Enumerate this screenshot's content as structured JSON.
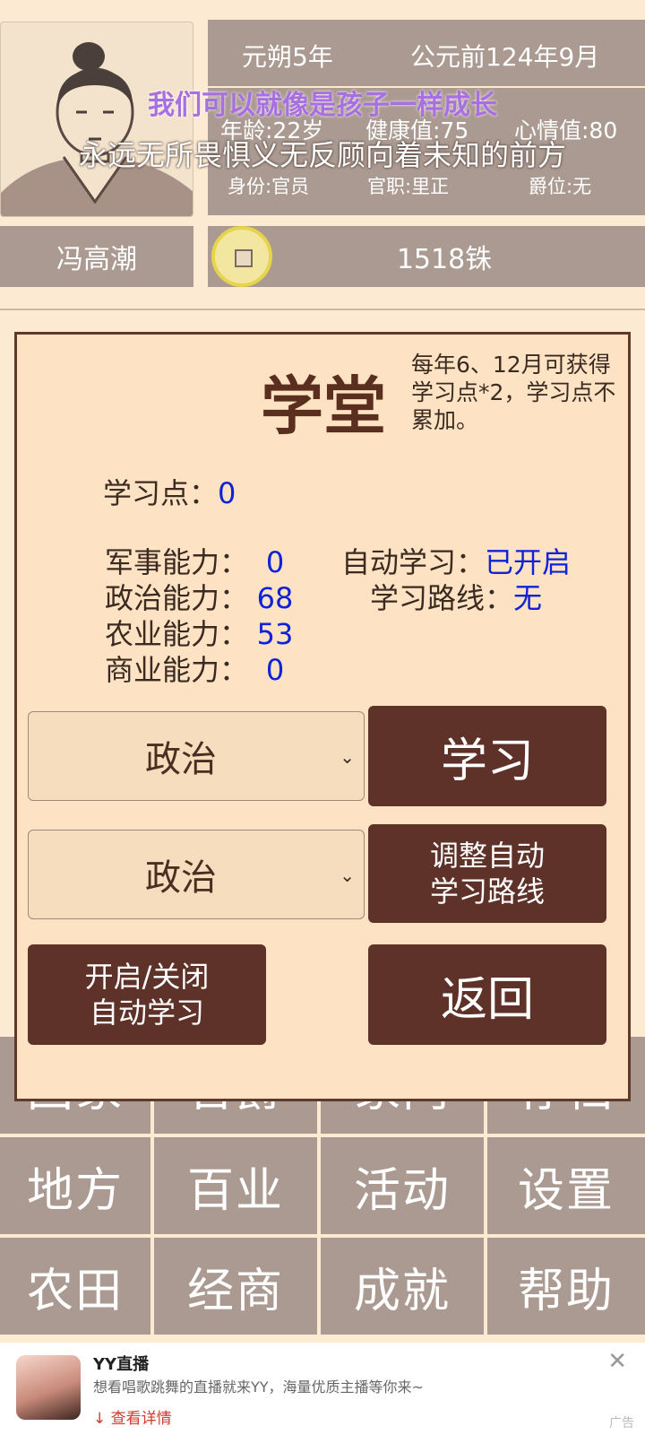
{
  "header": {
    "era": "元朔5年",
    "date": "公元前124年9月",
    "age": "年龄:22岁",
    "health": "健康值:75",
    "mood": "心情值:80",
    "identity": "身份:官员",
    "office": "官职:里正",
    "title_rank": "爵位:无",
    "name": "冯高潮",
    "money": "1518铢"
  },
  "lyrics": {
    "line1": "我们可以就像是孩子一样成长",
    "line2": "永远无所畏惧义无反顾向着未知的前方"
  },
  "modal": {
    "title": "学堂",
    "description": "每年6、12月可获得学习点*2，学习点不累加。",
    "study_points_label": "学习点：",
    "study_points_value": "0",
    "stats": [
      {
        "label": "军事能力：",
        "value": "0"
      },
      {
        "label": "政治能力：",
        "value": "68"
      },
      {
        "label": "农业能力：",
        "value": "53"
      },
      {
        "label": "商业能力：",
        "value": "0"
      }
    ],
    "auto_study_label": "自动学习：",
    "auto_study_value": "已开启",
    "route_label": "学习路线：",
    "route_value": "无",
    "select1": "政治",
    "select2": "政治",
    "study_button": "学习",
    "adjust_button_line1": "调整自动",
    "adjust_button_line2": "学习路线",
    "toggle_button_line1": "开启/关闭",
    "toggle_button_line2": "自动学习",
    "back_button": "返回"
  },
  "menu": {
    "row1": [
      "国家",
      "官爵",
      "家门",
      "存档"
    ],
    "row2": [
      "地方",
      "百业",
      "活动",
      "设置"
    ],
    "row3": [
      "农田",
      "经商",
      "成就",
      "帮助"
    ]
  },
  "ad": {
    "title": "YY直播",
    "text": "想看唱歌跳舞的直播就来YY，海量优质主播等你来~",
    "link": "查看详情",
    "tag": "广告"
  },
  "colors": {
    "background": "#fcebd2",
    "panel": "#ab9a91",
    "modal_bg": "#fde3c3",
    "button": "#5e3228",
    "value_blue": "#0f22d8",
    "lyric_purple": "#a86fe0"
  }
}
